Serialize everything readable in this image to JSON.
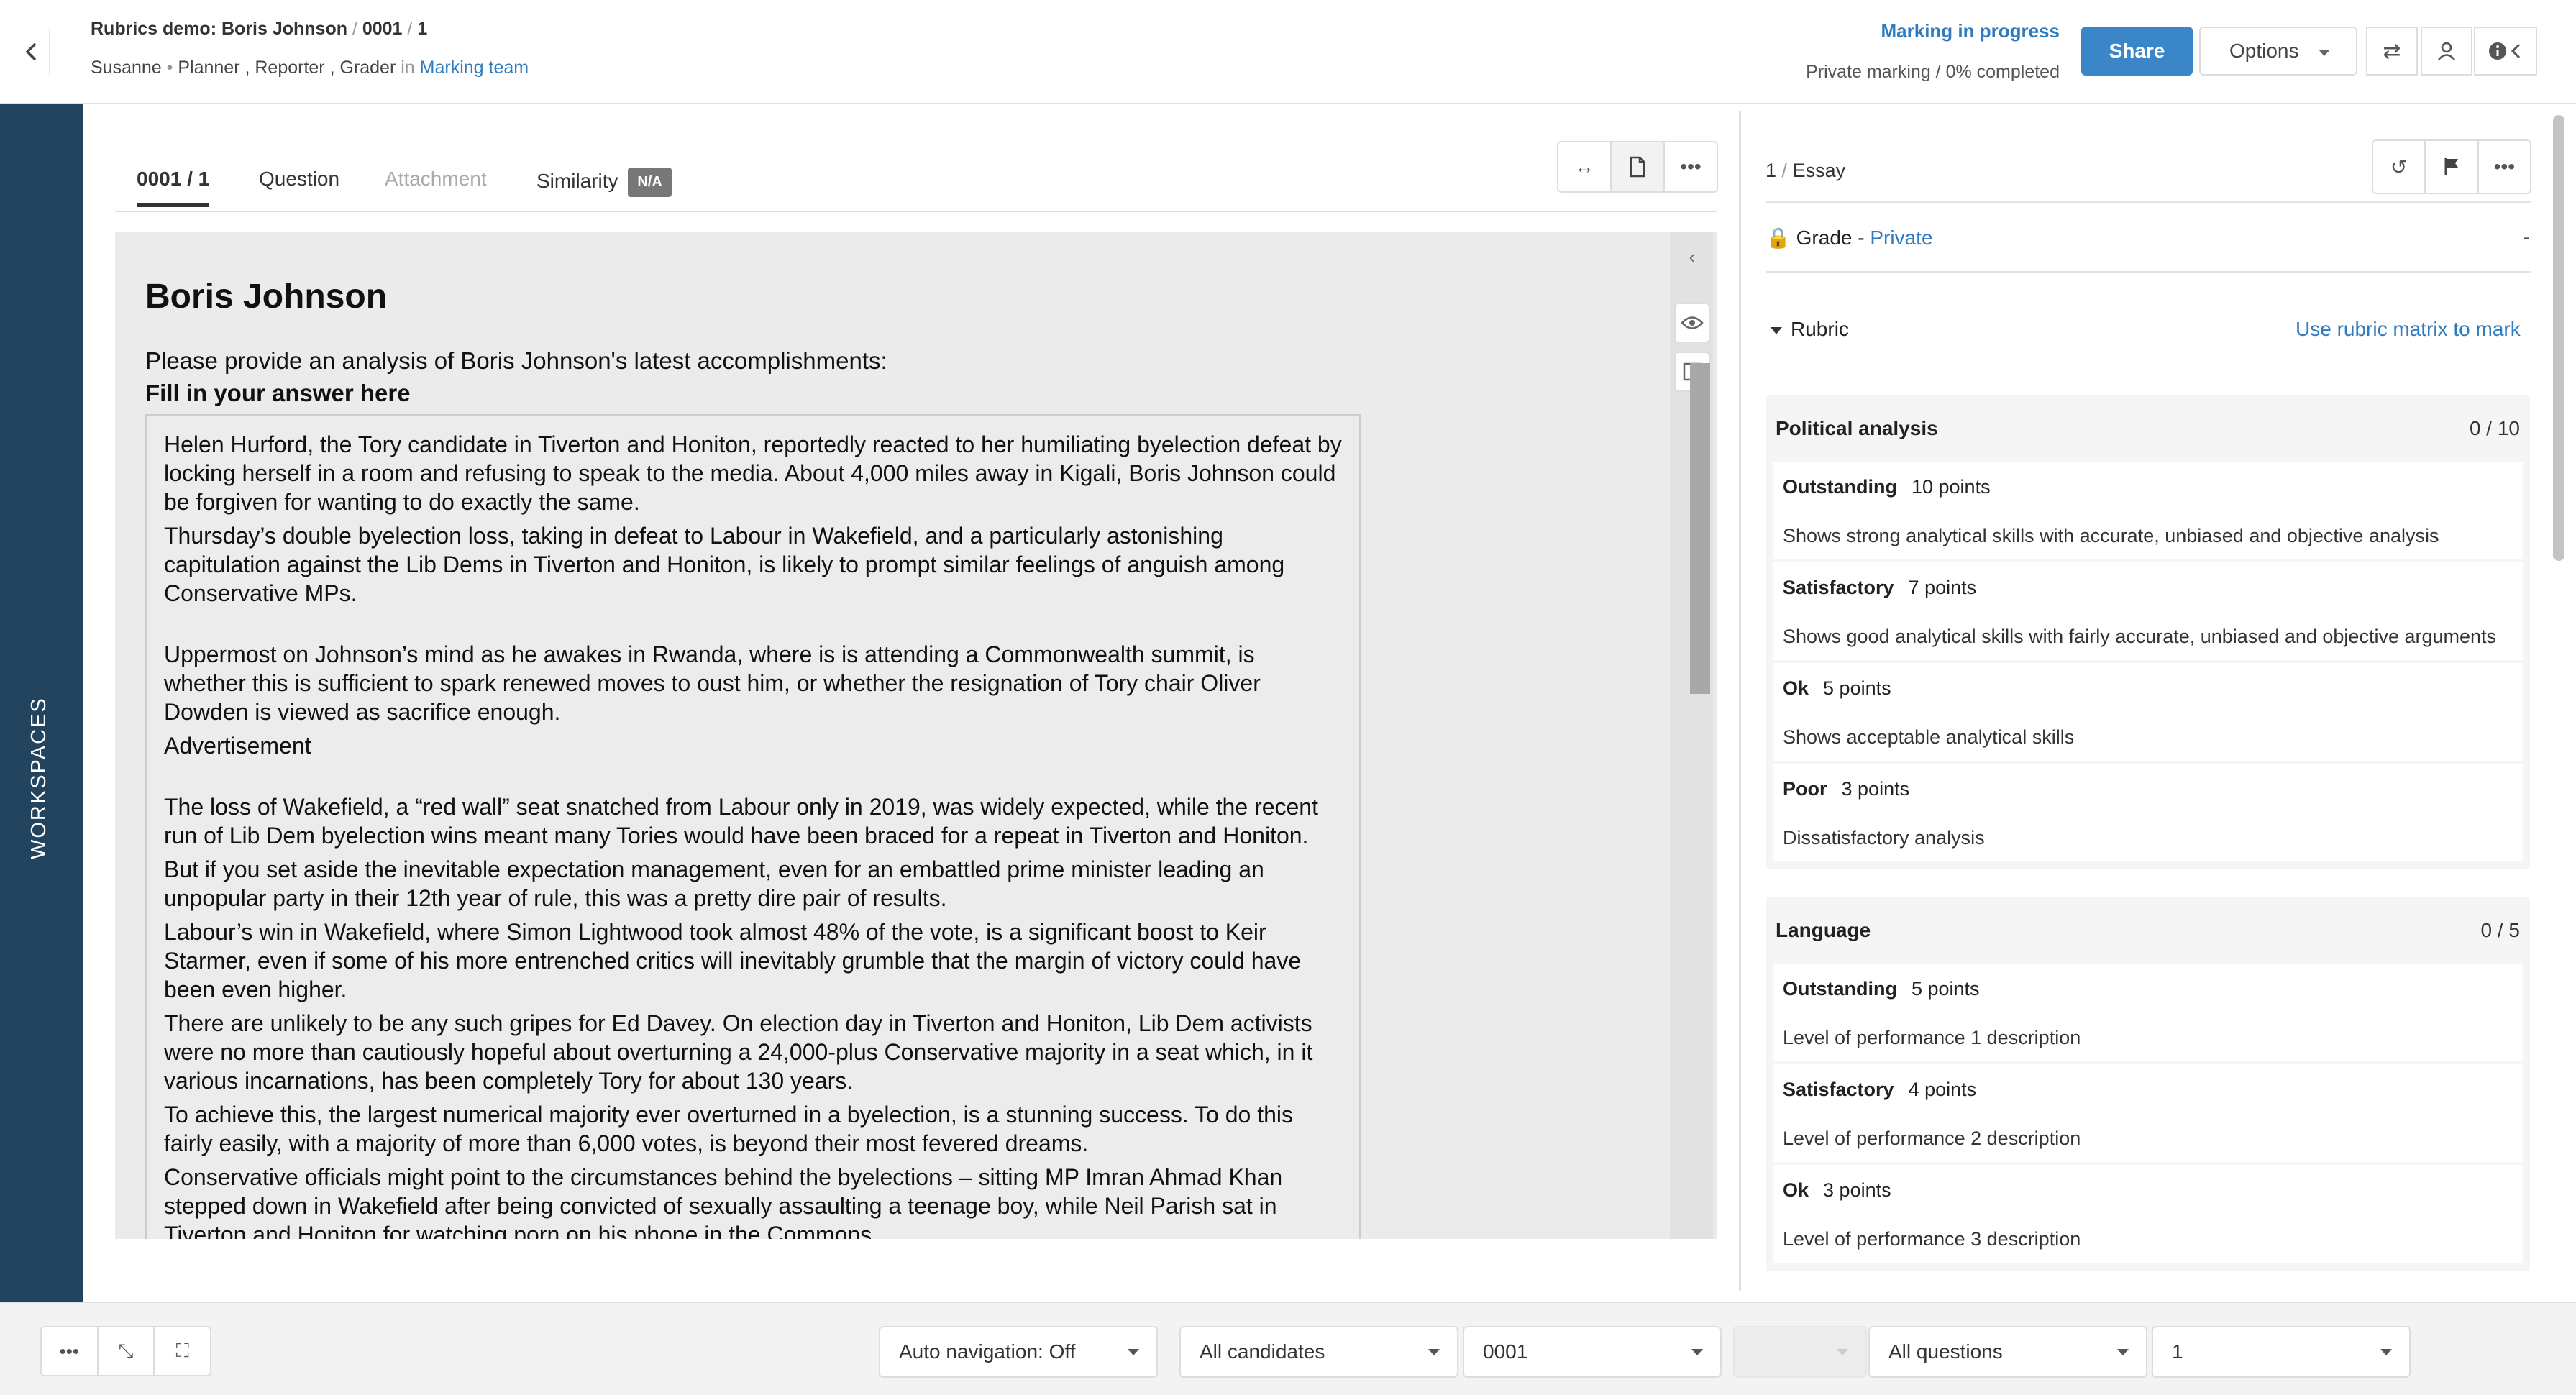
{
  "header": {
    "breadcrumb": [
      "Rubrics demo: Boris Johnson",
      "0001",
      "1"
    ],
    "user": "Susanne",
    "roles": "Planner , Reporter , Grader",
    "in_word": "in",
    "team": "Marking team",
    "status": "Marking in progress",
    "progress": "Private marking / 0% completed",
    "share": "Share",
    "options": "Options"
  },
  "sidebar": {
    "label": "WORKSPACES"
  },
  "tabs": {
    "candidate": "0001 / 1",
    "question": "Question",
    "attachment": "Attachment",
    "similarity": "Similarity",
    "similarity_badge": "N/A"
  },
  "document": {
    "title": "Boris Johnson",
    "prompt": "Please provide an analysis of Boris Johnson's latest accomplishments:",
    "fill": "Fill in your answer here",
    "paragraphs": [
      "Helen Hurford, the Tory candidate in Tiverton and Honiton, reportedly reacted to her humiliating byelection defeat by locking herself in a room and refusing to speak to the media. About 4,000 miles away in Kigali, Boris Johnson could be forgiven for wanting to do exactly the same.",
      "Thursday’s double byelection loss, taking in defeat to Labour in Wakefield, and a particularly astonishing capitulation against the Lib Dems in Tiverton and Honiton, is likely to prompt similar feelings of anguish among Conservative MPs.",
      "Uppermost on Johnson’s mind as he awakes in Rwanda, where is is attending a Commonwealth summit, is whether this is sufficient to spark renewed moves to oust him, or whether the resignation of Tory chair Oliver Dowden is viewed as sacrifice enough.",
      "Advertisement",
      "The loss of Wakefield, a “red wall” seat snatched from Labour only in 2019, was widely expected, while the recent run of Lib Dem byelection wins meant many Tories would have been braced for a repeat in Tiverton and Honiton.",
      "But if you set aside the inevitable expectation management, even for an embattled prime minister leading an unpopular party in their 12th year of rule, this was a pretty dire pair of results.",
      "Labour’s win in Wakefield, where Simon Lightwood took almost 48% of the vote, is a significant boost to Keir Starmer, even if some of his more entrenched critics will inevitably grumble that the margin of victory could have been even higher.",
      "There are unlikely to be any such gripes for Ed Davey. On election day in Tiverton and Honiton, Lib Dem activists were no more than cautiously hopeful about overturning a 24,000-plus Conservative majority in a seat which, in it various incarnations, has been completely Tory for about 130 years.",
      "To achieve this, the largest numerical majority ever overturned in a byelection, is a stunning success. To do this fairly easily, with a majority of more than 6,000 votes, is beyond their most fevered dreams.",
      "Conservative officials might point to the circumstances behind the byelections – sitting MP Imran Ahmad Khan stepped down in Wakefield after being convicted of sexually assaulting a teenage boy, while Neil Parish sat in Tiverton and Honiton for watching porn on his phone in the Commons."
    ]
  },
  "panel": {
    "question_num": "1",
    "question_type": "Essay",
    "grade_label": "Grade",
    "grade_privacy": "Private",
    "grade_value": "-",
    "rubric_label": "Rubric",
    "rubric_link": "Use rubric matrix to mark",
    "criteria": [
      {
        "name": "Political analysis",
        "score": "0 / 10",
        "levels": [
          {
            "name": "Outstanding",
            "points": "10 points",
            "desc": "Shows strong analytical skills with accurate,  unbiased and objective analysis"
          },
          {
            "name": "Satisfactory",
            "points": "7 points",
            "desc": "Shows good analytical skills with fairly accurate, unbiased and objective arguments"
          },
          {
            "name": "Ok",
            "points": "5 points",
            "desc": "Shows acceptable analytical skills"
          },
          {
            "name": "Poor",
            "points": "3 points",
            "desc": "Dissatisfactory analysis"
          }
        ]
      },
      {
        "name": "Language",
        "score": "0 / 5",
        "levels": [
          {
            "name": "Outstanding",
            "points": "5 points",
            "desc": "Level of performance 1 description"
          },
          {
            "name": "Satisfactory",
            "points": "4 points",
            "desc": "Level of performance 2 description"
          },
          {
            "name": "Ok",
            "points": "3 points",
            "desc": "Level of performance 3 description"
          }
        ]
      }
    ]
  },
  "bottom": {
    "auto_nav": "Auto navigation: Off",
    "candidates": "All candidates",
    "candidate_id": "0001",
    "questions": "All questions",
    "question_id": "1"
  },
  "colors": {
    "sidebar": "#23445f",
    "accent": "#3a86c8",
    "link": "#2f7bbf"
  },
  "icons": [
    "back-icon",
    "swap-icon",
    "user-icon",
    "info-icon",
    "collapse-icon",
    "expand-width-icon",
    "document-icon",
    "more-icon",
    "eye-icon",
    "note-icon",
    "undo-icon",
    "flag-icon",
    "lock-icon",
    "fullscreen-icon"
  ]
}
